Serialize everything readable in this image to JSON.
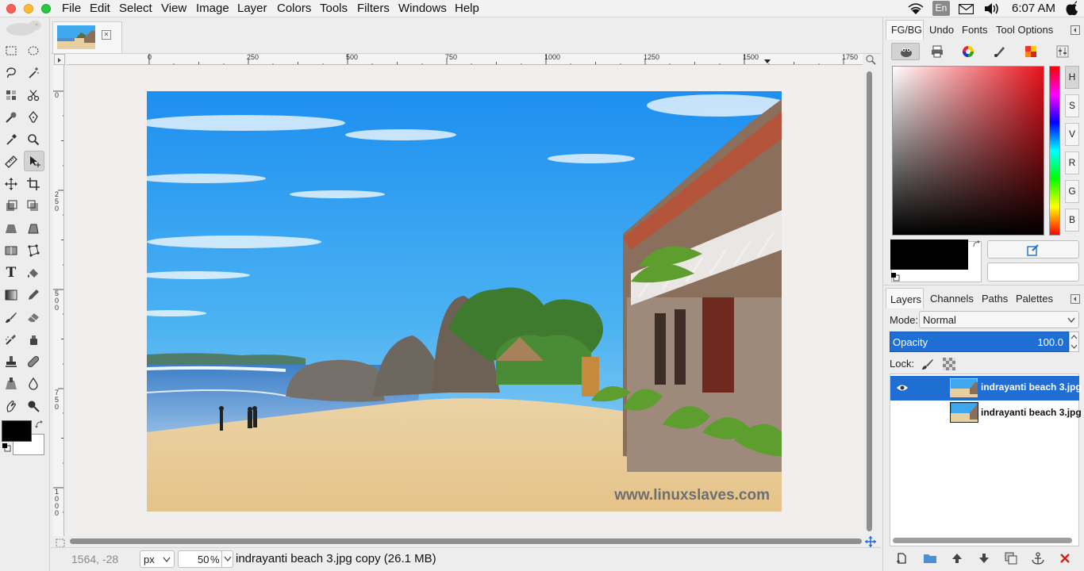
{
  "menubar": {
    "items": [
      "File",
      "Edit",
      "Select",
      "View",
      "Image",
      "Layer",
      "Colors",
      "Tools",
      "Filters",
      "Windows",
      "Help"
    ],
    "input_language": "En",
    "clock": "6:07 AM"
  },
  "image_tab": {
    "close_glyph": "✕"
  },
  "rulers": {
    "horizontal": [
      "0",
      "250",
      "500",
      "750",
      "1000",
      "1250",
      "1500",
      "1750"
    ],
    "vertical": [
      "0",
      "250",
      "500",
      "750",
      "1000"
    ]
  },
  "canvas_image": {
    "watermark": "www.linuxslaves.com"
  },
  "status": {
    "pointer": "1564, -28",
    "unit": "px",
    "zoom": "50",
    "zoom_unit": "%",
    "title": "indrayanti beach 3.jpg copy (26.1 MB)"
  },
  "dock_top": {
    "tabs": [
      "FG/BG",
      "Undo",
      "Fonts",
      "Tool Options"
    ],
    "channels": [
      "H",
      "S",
      "V",
      "R",
      "G",
      "B"
    ]
  },
  "dock_bottom": {
    "tabs": [
      "Layers",
      "Channels",
      "Paths",
      "Palettes"
    ],
    "mode_label": "Mode:",
    "mode_value": "Normal",
    "opacity_label": "Opacity",
    "opacity_value": "100.0",
    "lock_label": "Lock:",
    "layers": [
      {
        "name": "indrayanti beach 3.jpg",
        "visible": true,
        "selected": true
      },
      {
        "name": "indrayanti beach 3.jpg",
        "visible": false,
        "selected": false
      }
    ]
  },
  "colors": {
    "accent": "#1f6ed4",
    "foreground": "#000000",
    "background": "#ffffff"
  }
}
